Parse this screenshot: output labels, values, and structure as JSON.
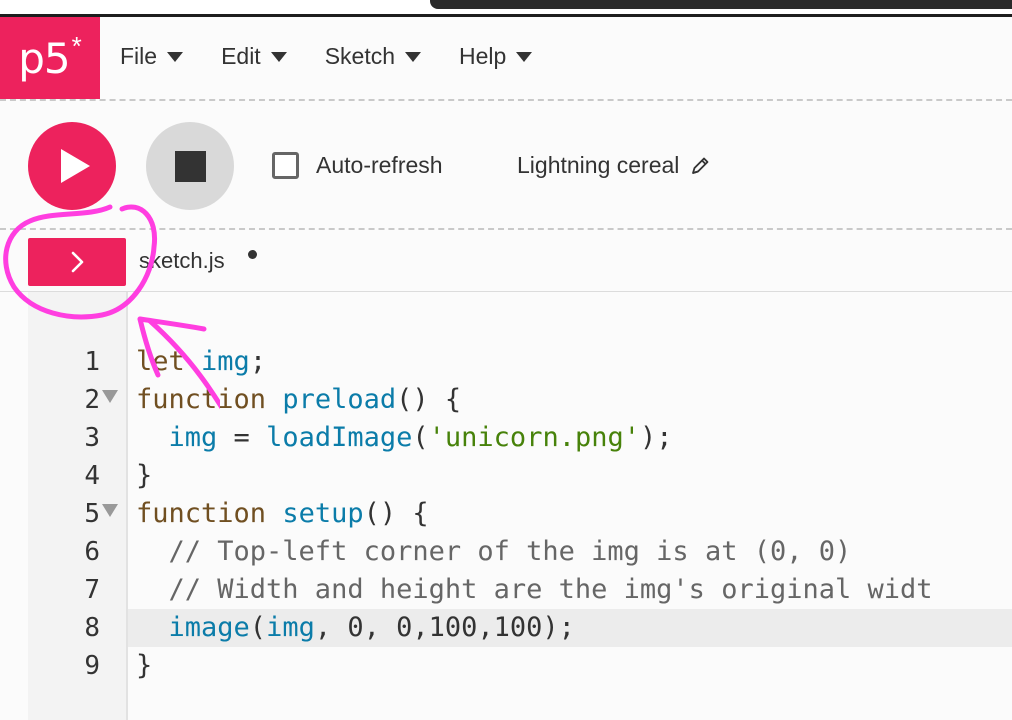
{
  "app": {
    "logo": "p5",
    "logo_star": "*",
    "accent_color": "#ed225d"
  },
  "menu": [
    {
      "label": "File"
    },
    {
      "label": "Edit"
    },
    {
      "label": "Sketch"
    },
    {
      "label": "Help"
    }
  ],
  "toolbar": {
    "play_icon": "play-icon",
    "stop_icon": "stop-icon",
    "autorefresh_label": "Auto-refresh",
    "autorefresh_checked": false,
    "project_name": "Lightning cereal",
    "edit_icon": "pencil-icon"
  },
  "file": {
    "expand_icon": "chevron-right-icon",
    "name": "sketch.js",
    "unsaved": true
  },
  "editor": {
    "active_line": 8,
    "line_numbers": [
      "1",
      "2",
      "3",
      "4",
      "5",
      "6",
      "7",
      "8",
      "9"
    ],
    "lines": [
      [
        {
          "t": "let ",
          "c": "kw"
        },
        {
          "t": "img",
          "c": "var"
        },
        {
          "t": ";",
          "c": ""
        }
      ],
      [
        {
          "t": "function ",
          "c": "kw"
        },
        {
          "t": "preload",
          "c": "fn"
        },
        {
          "t": "() {",
          "c": ""
        }
      ],
      [
        {
          "t": "  ",
          "c": ""
        },
        {
          "t": "img",
          "c": "var"
        },
        {
          "t": " = ",
          "c": ""
        },
        {
          "t": "loadImage",
          "c": "fn"
        },
        {
          "t": "(",
          "c": ""
        },
        {
          "t": "'unicorn.png'",
          "c": "str"
        },
        {
          "t": ");",
          "c": ""
        }
      ],
      [
        {
          "t": "}",
          "c": ""
        }
      ],
      [
        {
          "t": "function ",
          "c": "kw"
        },
        {
          "t": "setup",
          "c": "fn"
        },
        {
          "t": "() {",
          "c": ""
        }
      ],
      [
        {
          "t": "  // Top-left corner of the img is at (0, 0)",
          "c": "cm"
        }
      ],
      [
        {
          "t": "  // Width and height are the img's original widt",
          "c": "cm"
        }
      ],
      [
        {
          "t": "  ",
          "c": ""
        },
        {
          "t": "image",
          "c": "fn"
        },
        {
          "t": "(",
          "c": ""
        },
        {
          "t": "img",
          "c": "var"
        },
        {
          "t": ", 0, 0,100,100);",
          "c": ""
        }
      ],
      [
        {
          "t": "}",
          "c": ""
        }
      ]
    ],
    "foldable_lines": [
      2,
      5
    ]
  }
}
